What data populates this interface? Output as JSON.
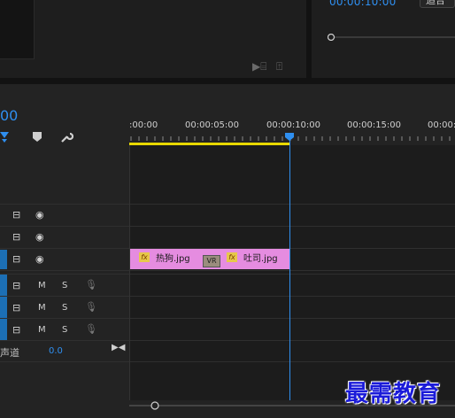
{
  "program_monitor": {
    "timecode": "00:00:10:00",
    "fit_label": "适合"
  },
  "sequence": {
    "timecode_partial": "00"
  },
  "ruler": {
    "labels": [
      ":00:00",
      "00:00:05:00",
      "00:00:10:00",
      "00:00:15:00",
      "00:00:2"
    ]
  },
  "tracks": {
    "mute_label": "M",
    "solo_label": "S",
    "mix_label": "声道",
    "mix_value": "0.0"
  },
  "clips": [
    {
      "name": "热狗.jpg",
      "fx": "fx"
    },
    {
      "name": "吐司.jpg",
      "fx": "fx"
    }
  ],
  "transition": {
    "label": "VR"
  },
  "colors": {
    "accent": "#2f8ff0",
    "clip": "#e58ce0",
    "workarea": "#e8d800",
    "track_tag": "#1c6fb5"
  },
  "watermark": "最需教育"
}
